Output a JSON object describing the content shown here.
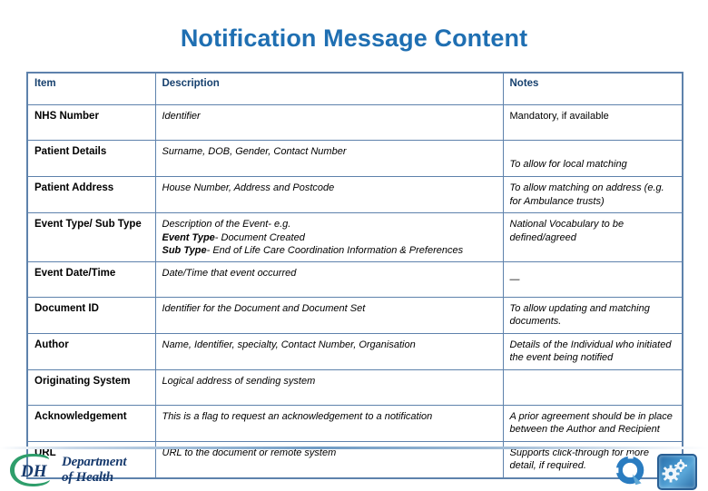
{
  "slide": {
    "title": "Notification Message Content",
    "title_color": "#1f6fb2"
  },
  "table": {
    "headers": {
      "item": "Item",
      "description": "Description",
      "notes": "Notes"
    },
    "rows": [
      {
        "item": "NHS Number",
        "description": "Identifier",
        "notes": "Mandatory, if available"
      },
      {
        "item": "Patient Details",
        "description": "Surname,  DOB, Gender, Contact Number",
        "notes": "To allow for local matching"
      },
      {
        "item": "Patient Address",
        "description": "House Number, Address and Postcode",
        "notes": "To allow matching on address (e.g. for Ambulance trusts)"
      },
      {
        "item": "Event Type/ Sub Type",
        "description_lines": [
          {
            "lead": "",
            "text": "Description of the Event- e.g."
          },
          {
            "lead": "Event Type",
            "text": "- Document Created"
          },
          {
            "lead": "Sub Type",
            "text": "- End of Life Care Coordination Information & Preferences"
          }
        ],
        "notes": "National Vocabulary to be defined/agreed"
      },
      {
        "item": "Event Date/Time",
        "description": "Date/Time that event occurred",
        "notes": "—"
      },
      {
        "item": "Document ID",
        "description": "Identifier for the Document and Document Set",
        "notes": "To allow updating and matching documents."
      },
      {
        "item": "Author",
        "description": "Name, Identifier, specialty, Contact Number, Organisation",
        "notes": "Details of the Individual who initiated the event being notified"
      },
      {
        "item": "Originating System",
        "description": "Logical address of sending system",
        "notes": ""
      },
      {
        "item": "Acknowledgement",
        "description": "This is a flag to request an acknowledgement to a notification",
        "notes": "A prior agreement should be in place between the Author and Recipient"
      },
      {
        "item": "URL",
        "description": "URL to the document or remote system",
        "notes": "Supports click-through for more detail, if required."
      }
    ]
  },
  "footer": {
    "logo": {
      "mark": "DH",
      "line1": "Department",
      "line2": "of Health"
    },
    "badges": [
      {
        "name": "q-mark-logo"
      },
      {
        "name": "gear-tile-logo"
      }
    ]
  }
}
